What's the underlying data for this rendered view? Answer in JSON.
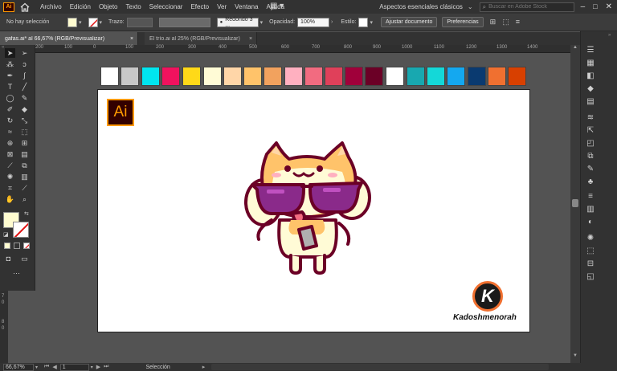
{
  "app": {
    "logo": "Ai",
    "home_icon": "home-icon"
  },
  "menu": [
    "Archivo",
    "Edición",
    "Objeto",
    "Texto",
    "Seleccionar",
    "Efecto",
    "Ver",
    "Ventana",
    "Ayuda"
  ],
  "workspace": {
    "label": "Aspectos esenciales clásicos",
    "search_placeholder": "Buscar en Adobe Stock"
  },
  "control": {
    "selection": "No hay selección",
    "stroke_label": "Trazo:",
    "brush": "Redondo 3 ...",
    "opacity_label": "Opacidad:",
    "opacity": "100%",
    "style_label": "Estilo:",
    "doc_button": "Ajustar documento",
    "prefs_button": "Preferencias"
  },
  "tabs": [
    {
      "label": "gafas.ai* al 66,67% (RGB/Previsualizar)",
      "close": "×"
    },
    {
      "label": "El trío.ai al 25% (RGB/Previsualizar)",
      "close": "×"
    }
  ],
  "ruler": {
    "ticks": [
      "200",
      "100",
      "0",
      "100",
      "200",
      "300",
      "400",
      "500",
      "600",
      "700",
      "800",
      "900",
      "1000",
      "1100",
      "1200",
      "1300",
      "1400"
    ]
  },
  "ruler_left": {
    "ticks": [
      "7",
      "0",
      "8",
      "0"
    ]
  },
  "swatches": [
    "#ffffff",
    "#c8c8c8",
    "#00e5ef",
    "#f0125e",
    "#ffd918",
    "#fffbd6",
    "#ffd6a8",
    "#ffc36a",
    "#f2a25e",
    "#ffb0c0",
    "#f26b80",
    "#e0405a",
    "#a0003a",
    "#6b0026",
    "#ffffff",
    "#18a8b0",
    "#14d8d8",
    "#14a8f0",
    "#0a3a70",
    "#f07030",
    "#d84000"
  ],
  "colors": {
    "fill": "#fffcd0",
    "accent": "#ff9a00"
  },
  "artboard": {
    "ai_badge": "Ai",
    "brand_initial": "K",
    "brand": "Kadoshmenorah"
  },
  "status": {
    "zoom": "66,67%",
    "page": "1",
    "mode": "Selección"
  }
}
